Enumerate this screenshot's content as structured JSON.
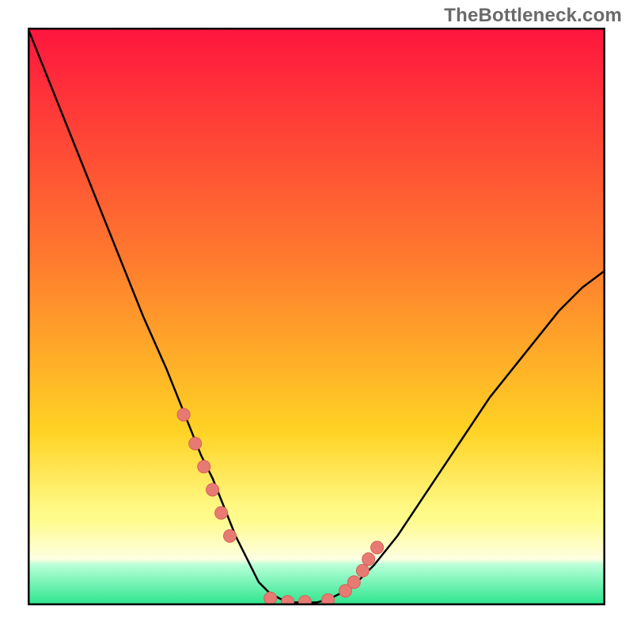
{
  "watermark": "TheBottleneck.com",
  "colors": {
    "grad_top": "#ff153e",
    "grad_mid1": "#ff7a2e",
    "grad_mid2": "#ffd324",
    "grad_band_yellow": "#fffb8a",
    "grad_band_green": "#29e58b",
    "curve": "#000000",
    "marker_fill": "#e77b74",
    "marker_stroke": "#d85f58",
    "border": "#000000"
  },
  "chart_data": {
    "type": "line",
    "title": "",
    "xlabel": "",
    "ylabel": "",
    "xlim": [
      0,
      100
    ],
    "ylim": [
      0,
      100
    ],
    "series": [
      {
        "name": "bottleneck-curve",
        "x": [
          0,
          4,
          8,
          12,
          16,
          20,
          24,
          28,
          30,
          32,
          34,
          36,
          38,
          40,
          42,
          44,
          46,
          48,
          50,
          52,
          56,
          60,
          64,
          68,
          72,
          76,
          80,
          84,
          88,
          92,
          96,
          100
        ],
        "y": [
          100,
          90,
          80,
          70,
          60,
          50,
          41,
          31,
          26,
          22,
          17,
          12,
          8,
          4,
          2,
          1,
          0.5,
          0.5,
          0.5,
          1,
          3,
          7,
          12,
          18,
          24,
          30,
          36,
          41,
          46,
          51,
          55,
          58
        ]
      }
    ],
    "markers": {
      "name": "highlighted-points",
      "x": [
        27,
        29,
        30.5,
        32,
        33.5,
        35,
        42,
        45,
        48,
        52,
        55,
        56.5,
        58,
        59,
        60.5
      ],
      "y": [
        33,
        28,
        24,
        20,
        16,
        12,
        1.2,
        0.6,
        0.6,
        0.9,
        2.5,
        4,
        6,
        8,
        10
      ]
    }
  }
}
